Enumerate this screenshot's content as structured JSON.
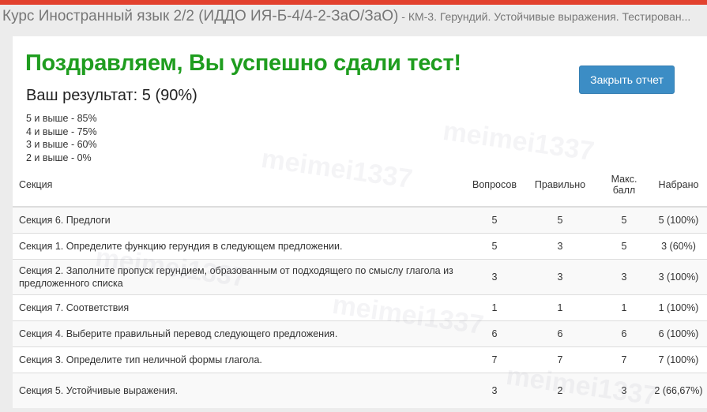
{
  "header": {
    "course": "Курс Иностранный язык 2/2 (ИДДО ИЯ-Б-4/4-2-ЗаО/ЗаО)",
    "subtitle": " - КМ-3. Герундий. Устойчивые выражения. Тестирован..."
  },
  "result": {
    "title": "Поздравляем, Вы успешно сдали тест!",
    "score": "Ваш результат: 5 (90%)",
    "close_button": "Закрыть отчет",
    "grades": [
      "5 и выше - 85%",
      "4 и выше - 75%",
      "3 и выше - 60%",
      "2 и выше - 0%"
    ]
  },
  "table": {
    "headers": {
      "section": "Секция",
      "questions": "Вопросов",
      "correct": "Правильно",
      "max_a": "Макс.",
      "max_b": "балл",
      "scored": "Набрано"
    },
    "rows": [
      {
        "section": "Секция 6. Предлоги",
        "questions": "5",
        "correct": "5",
        "max": "5",
        "scored": "5 (100%)"
      },
      {
        "section": "Секция 1. Определите функцию герундия в следующем предложении.",
        "questions": "5",
        "correct": "3",
        "max": "5",
        "scored": "3 (60%)"
      },
      {
        "section": "Секция 2. Заполните пропуск герундием, образованным от подходящего по смыслу глагола из предложенного списка",
        "questions": "3",
        "correct": "3",
        "max": "3",
        "scored": "3 (100%)"
      },
      {
        "section": "Секция 7. Соответствия",
        "questions": "1",
        "correct": "1",
        "max": "1",
        "scored": "1 (100%)"
      },
      {
        "section": "Секция 4. Выберите правильный перевод следующего предложения.",
        "questions": "6",
        "correct": "6",
        "max": "6",
        "scored": "6 (100%)"
      },
      {
        "section": "Секция 3. Определите тип неличной формы глагола.",
        "questions": "7",
        "correct": "7",
        "max": "7",
        "scored": "7 (100%)"
      },
      {
        "section": "Секция 5. Устойчивые выражения.",
        "questions": "3",
        "correct": "2",
        "max": "3",
        "scored": "2 (66,67%)"
      }
    ]
  },
  "watermark": "meimei1337",
  "colors": {
    "accent_bar": "#e2412e",
    "success_title": "#1f9d1f",
    "button": "#3c8dc5"
  }
}
